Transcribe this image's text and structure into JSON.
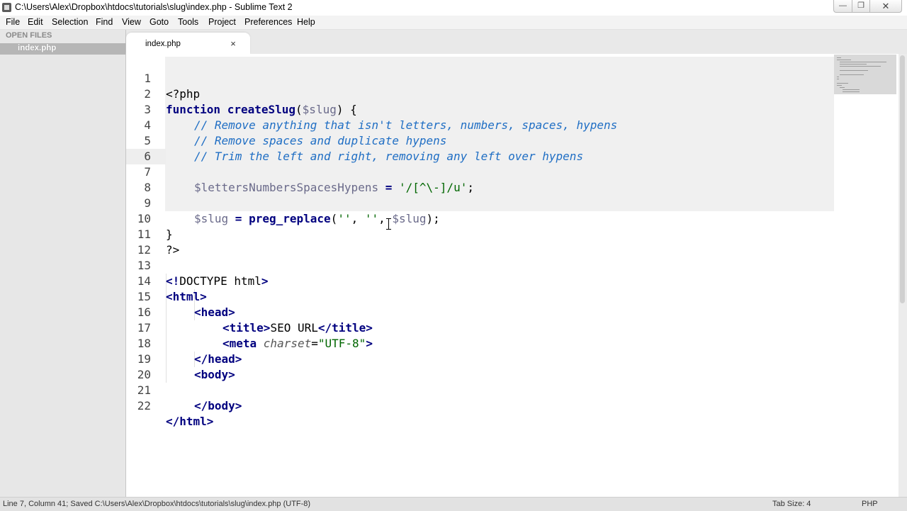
{
  "window": {
    "title": "C:\\Users\\Alex\\Dropbox\\htdocs\\tutorials\\slug\\index.php - Sublime Text 2",
    "controls": {
      "minimize": "—",
      "maximize": "❐",
      "close": "✕"
    }
  },
  "menu": [
    "File",
    "Edit",
    "Selection",
    "Find",
    "View",
    "Goto",
    "Tools",
    "Project",
    "Preferences",
    "Help"
  ],
  "sidebar": {
    "header": "OPEN FILES",
    "files": [
      "index.php"
    ]
  },
  "tabs": [
    {
      "label": "index.php",
      "close": "×",
      "active": true
    }
  ],
  "editor": {
    "cursor_line": 7,
    "lines": [
      {
        "n": "1"
      },
      {
        "n": "2"
      },
      {
        "n": "3"
      },
      {
        "n": "4"
      },
      {
        "n": "5"
      },
      {
        "n": "6"
      },
      {
        "n": "7"
      },
      {
        "n": "8"
      },
      {
        "n": "9"
      },
      {
        "n": "10"
      },
      {
        "n": "11"
      },
      {
        "n": "12"
      },
      {
        "n": "13"
      },
      {
        "n": "14"
      },
      {
        "n": "15"
      },
      {
        "n": "16"
      },
      {
        "n": "17"
      },
      {
        "n": "18"
      },
      {
        "n": "19"
      },
      {
        "n": "20"
      },
      {
        "n": "21"
      },
      {
        "n": "22"
      }
    ],
    "code": {
      "l1": "<?php",
      "l2_kw": "function",
      "l2_fn": "createSlug",
      "l2_open": "(",
      "l2_var": "$slug",
      "l2_close": ") {",
      "l3": "// Remove anything that isn't letters, numbers, spaces, hypens",
      "l4": "// Remove spaces and duplicate hypens",
      "l5": "// Trim the left and right, removing any left over hypens",
      "l7_var": "$lettersNumbersSpacesHypens",
      "l7_op": " = ",
      "l7_str": "'/[^\\-]/u'",
      "l7_end": ";",
      "l9_var": "$slug",
      "l9_op": " = ",
      "l9_fn": "preg_replace",
      "l9_p1": "(",
      "l9_s1": "''",
      "l9_c1": ", ",
      "l9_s2": "''",
      "l9_c2": ", ",
      "l9_v2": "$slug",
      "l9_end": ");",
      "l10": "}",
      "l11": "?>",
      "l13_a": "<!",
      "l13_b": "DOCTYPE html",
      "l13_c": ">",
      "l14": "<html>",
      "l15": "<head>",
      "l16_a": "<title>",
      "l16_b": "SEO URL",
      "l16_c": "</title>",
      "l17_a": "<meta ",
      "l17_attr": "charset",
      "l17_eq": "=",
      "l17_val": "\"UTF-8\"",
      "l17_c": ">",
      "l18": "</head>",
      "l19": "<body>",
      "l21": "</body>",
      "l22": "</html>"
    }
  },
  "status": {
    "text": "Line 7, Column 41; Saved C:\\Users\\Alex\\Dropbox\\htdocs\\tutorials\\slug\\index.php (UTF-8)",
    "tab_size": "Tab Size: 4",
    "syntax": "PHP"
  }
}
